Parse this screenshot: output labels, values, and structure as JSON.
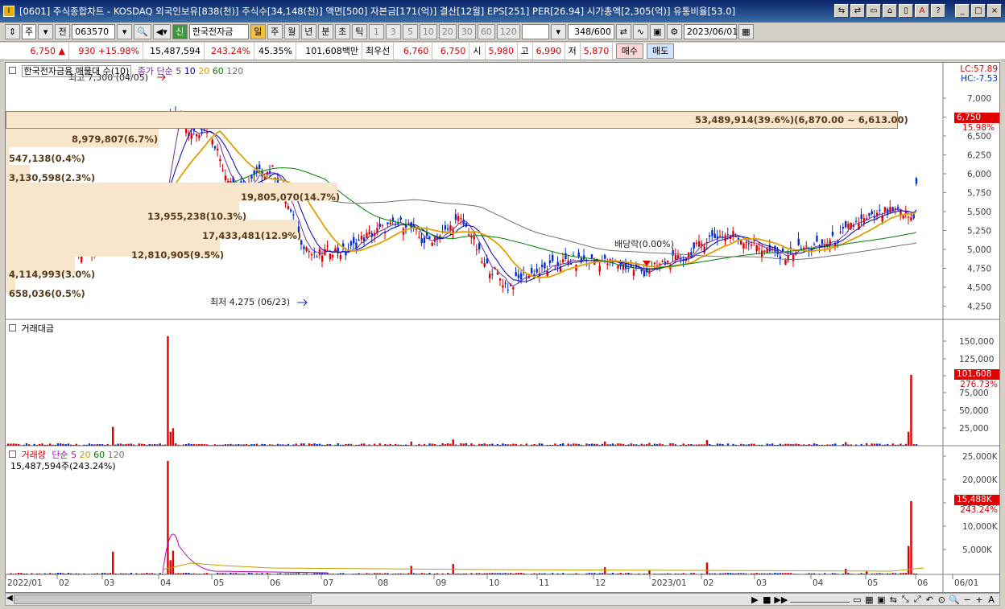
{
  "window": {
    "title": "[0601] 주식종합차트 - KOSDAQ 외국인보유[838(천)] 주식수[34,148(천)] 액면[500] 자본금[171(억)] 결산[12월] EPS[251] PER[26.94] 시가총액[2,305(억)] 유통비율[53.0]",
    "buttons": [
      "⇆",
      "⇄",
      "▭",
      "⌂",
      "▯",
      "A",
      "?",
      "_",
      "□",
      "×"
    ]
  },
  "toolbar": {
    "market": "주",
    "mode": "전",
    "code": "063570",
    "stock_name": "한국전자금",
    "stock_prefix": "신",
    "periods": [
      "일",
      "주",
      "월",
      "년",
      "분",
      "초",
      "틱"
    ],
    "minutes": [
      "1",
      "3",
      "5",
      "10",
      "20",
      "30",
      "60",
      "120"
    ],
    "count": "348",
    "count_total": "/600",
    "date": "2023/06/01"
  },
  "quote": {
    "price": "6,750",
    "arrow": "▲",
    "change": "930",
    "change_pct": "+15.98%",
    "volume": "15,487,594",
    "vol_ratio": "243.24%",
    "turnover": "45.35%",
    "amount": "101,608백만",
    "best_label": "최우선",
    "ask": "6,760",
    "bid": "6,750",
    "open_label": "시",
    "open": "5,980",
    "high_label": "고",
    "high": "6,990",
    "low_label": "저",
    "low": "5,870",
    "buy_label": "매수",
    "sell_label": "매도"
  },
  "price_pane": {
    "title": "한국전자금융 매물대 수(10)",
    "ma_title": "종가 단순",
    "ma_periods": [
      "5",
      "10",
      "20",
      "60",
      "120"
    ],
    "lc": "LC:57.89",
    "hc": "HC:-7.53",
    "current_tag": "6,750",
    "current_pct": "15.98%",
    "high_note": "최고 7,300 (04/05)",
    "low_note": "최저 4,275 (06/23)",
    "dividend_note": "배당락(0.00%)",
    "yticks": [
      "7,000",
      "6,750",
      "6,500",
      "6,250",
      "6,000",
      "5,750",
      "5,500",
      "5,250",
      "5,000",
      "4,750",
      "4,500",
      "4,250"
    ],
    "volume_profile": [
      {
        "label": "53,489,914(39.6%)(6,870.00 ~ 6,613.00)",
        "pct": 39.6
      },
      {
        "label": "8,979,807(6.7%)",
        "pct": 6.7
      },
      {
        "label": "547,138(0.4%)",
        "pct": 0.4
      },
      {
        "label": "3,130,598(2.3%)",
        "pct": 2.3
      },
      {
        "label": "19,805,070(14.7%)",
        "pct": 14.7
      },
      {
        "label": "13,955,238(10.3%)",
        "pct": 10.3
      },
      {
        "label": "17,433,481(12.9%)",
        "pct": 12.9
      },
      {
        "label": "12,810,905(9.5%)",
        "pct": 9.5
      },
      {
        "label": "4,114,993(3.0%)",
        "pct": 3.0
      },
      {
        "label": "658,036(0.5%)",
        "pct": 0.5
      }
    ]
  },
  "amount_pane": {
    "title": "거래대금",
    "yticks": [
      "150,000",
      "125,000",
      "100,000",
      "75,000",
      "50,000",
      "25,000"
    ],
    "current_tag": "101,608",
    "current_pct": "276.73%"
  },
  "volume_pane": {
    "title": "거래량",
    "ma_title": "단순",
    "ma_periods": [
      "5",
      "20",
      "60",
      "120"
    ],
    "value_line": "15,487,594주(243.24%)",
    "yticks": [
      "25,000K",
      "20,000K",
      "15,000K",
      "10,000K",
      "5,000K"
    ],
    "current_tag": "15,488K",
    "current_pct": "243.24%"
  },
  "xaxis": [
    "2022/01",
    "02",
    "03",
    "04",
    "05",
    "06",
    "07",
    "08",
    "09",
    "10",
    "11",
    "12",
    "2023/01",
    "02",
    "03",
    "04",
    "05",
    "06",
    "06/01"
  ],
  "colors": {
    "up": "#e00000",
    "down": "#0030d0",
    "ma5": "#7030a0",
    "ma10": "#0000c0",
    "ma20": "#e0a000",
    "ma60": "#008000",
    "ma120": "#707070"
  }
}
